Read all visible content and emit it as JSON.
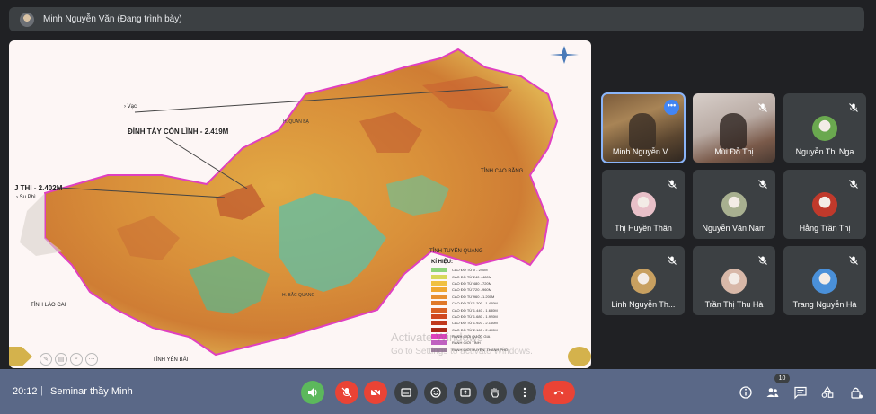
{
  "presenter": {
    "name": "Minh Nguyễn Văn (Đang trình bày)"
  },
  "slide": {
    "labels": {
      "vac": "› Vạc",
      "dinh": "ĐỈNH TÂY CÔN LĨNH - 2.419M",
      "thi": "J THI - 2.402M",
      "suphi": "› Su Phì",
      "caobang": "TỈNH CAO BẰNG",
      "tuyenquang": "TỈNH TUYÊN QUANG",
      "laocai": "TỈNH LÀO CAI",
      "yenbai": "TỈNH YÊN BÁI",
      "quanba": "H. QUẢN BẠ",
      "bacquang": "H. BẮC QUANG"
    },
    "legend_title": "KÍ HIỆU:",
    "legend": [
      {
        "label": "CAO ĐỘ TỪ 0 - 240M",
        "color": "#8fd47a"
      },
      {
        "label": "CAO ĐỘ TỪ 240 - 480M",
        "color": "#d8d85a"
      },
      {
        "label": "CAO ĐỘ TỪ 480 - 720M",
        "color": "#f0c040"
      },
      {
        "label": "CAO ĐỘ TỪ 720 - 960M",
        "color": "#f0a830"
      },
      {
        "label": "CAO ĐỘ TỪ 960 - 1.200M",
        "color": "#e89030"
      },
      {
        "label": "CAO ĐỘ TỪ 1.200 - 1.440M",
        "color": "#e07828"
      },
      {
        "label": "CAO ĐỘ TỪ 1.440 - 1.680M",
        "color": "#d86024"
      },
      {
        "label": "CAO ĐỘ TỪ 1.680 - 1.920M",
        "color": "#d04820"
      },
      {
        "label": "CAO ĐỘ TỪ 1.920 - 2.160M",
        "color": "#c0381c"
      },
      {
        "label": "CAO ĐỘ TỪ 2.160 - 2.400M",
        "color": "#a82818"
      },
      {
        "label": "RANH GIỚI QUỐC GIA",
        "color": "#e040c0"
      },
      {
        "label": "RANH GIỚI TỈNH",
        "color": "#c060c0"
      },
      {
        "label": "RANH GIỚI HUYỆN, THÀNH PHỐ",
        "color": "#a080a0"
      }
    ],
    "watermark_line1": "Activate Windows",
    "watermark_line2": "Go to Settings to activate Windows."
  },
  "participants": [
    {
      "name": "Minh Nguyễn V...",
      "type": "video",
      "active": true
    },
    {
      "name": "Mùi Đỗ Thị",
      "type": "video",
      "muted": true
    },
    {
      "name": "Nguyễn Thị Nga",
      "type": "avatar",
      "muted": true,
      "color": "#6aa84f"
    },
    {
      "name": "Thị Huyền Thân",
      "type": "avatar",
      "muted": true,
      "color": "#e8c0c8"
    },
    {
      "name": "Nguyễn Văn Nam",
      "type": "avatar",
      "muted": true,
      "color": "#a8b090"
    },
    {
      "name": "Hằng Trần Thị",
      "type": "avatar",
      "muted": true,
      "color": "#c0392b"
    },
    {
      "name": "Linh Nguyễn Th...",
      "type": "avatar",
      "muted": true,
      "color": "#c8a060"
    },
    {
      "name": "Trần Thị Thu Hà",
      "type": "avatar",
      "muted": true,
      "color": "#d8b8a8"
    },
    {
      "name": "Trang Nguyễn Hà",
      "type": "avatar",
      "muted": true,
      "color": "#4a90d9"
    }
  ],
  "bottom": {
    "time": "20:12",
    "separator": "|",
    "title": "Seminar thầy Minh",
    "people_count": "10"
  },
  "icons": {
    "volume": "volume-icon",
    "mic": "mic-off-icon",
    "camera": "camera-off-icon",
    "captions": "captions-icon",
    "emoji": "emoji-icon",
    "present": "present-icon",
    "hand": "raise-hand-icon",
    "more": "more-options-icon",
    "hangup": "hang-up-icon",
    "info": "info-icon",
    "people": "people-icon",
    "chat": "chat-icon",
    "activities": "activities-icon",
    "lock": "host-controls-icon"
  }
}
